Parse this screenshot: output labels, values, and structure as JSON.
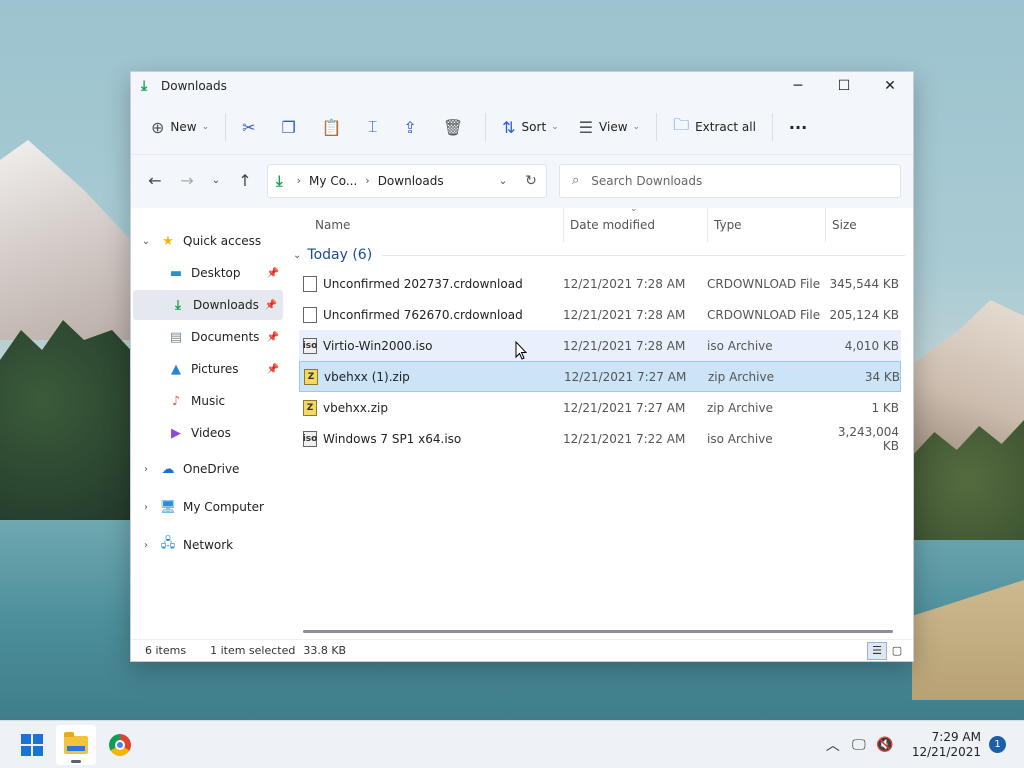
{
  "window": {
    "title": "Downloads",
    "controls": {
      "minimize": "─",
      "maximize": "☐",
      "close": "✕"
    }
  },
  "toolbar": {
    "new_label": "New",
    "sort_label": "Sort",
    "view_label": "View",
    "extract_label": "Extract all",
    "more_label": "···"
  },
  "address": {
    "crumbs": [
      "My Co...",
      "Downloads"
    ],
    "search_placeholder": "Search Downloads"
  },
  "sidebar": {
    "items": [
      {
        "label": "Quick access",
        "icon": "star-icon"
      },
      {
        "label": "Desktop",
        "icon": "desktop-icon"
      },
      {
        "label": "Downloads",
        "icon": "download-icon"
      },
      {
        "label": "Documents",
        "icon": "documents-icon"
      },
      {
        "label": "Pictures",
        "icon": "pictures-icon"
      },
      {
        "label": "Music",
        "icon": "music-icon"
      },
      {
        "label": "Videos",
        "icon": "videos-icon"
      },
      {
        "label": "OneDrive",
        "icon": "onedrive-icon"
      },
      {
        "label": "My Computer",
        "icon": "computer-icon"
      },
      {
        "label": "Network",
        "icon": "network-icon"
      }
    ]
  },
  "columns": {
    "name": "Name",
    "date": "Date modified",
    "type": "Type",
    "size": "Size"
  },
  "group": {
    "label": "Today (6)"
  },
  "files": [
    {
      "name": "Unconfirmed 202737.crdownload",
      "date": "12/21/2021 7:28 AM",
      "type": "CRDOWNLOAD File",
      "size": "345,544 KB",
      "kind": "doc"
    },
    {
      "name": "Unconfirmed 762670.crdownload",
      "date": "12/21/2021 7:28 AM",
      "type": "CRDOWNLOAD File",
      "size": "205,124 KB",
      "kind": "doc"
    },
    {
      "name": "Virtio-Win2000.iso",
      "date": "12/21/2021 7:28 AM",
      "type": "iso Archive",
      "size": "4,010 KB",
      "kind": "iso"
    },
    {
      "name": "vbehxx (1).zip",
      "date": "12/21/2021 7:27 AM",
      "type": "zip Archive",
      "size": "34 KB",
      "kind": "zip"
    },
    {
      "name": "vbehxx.zip",
      "date": "12/21/2021 7:27 AM",
      "type": "zip Archive",
      "size": "1 KB",
      "kind": "zip"
    },
    {
      "name": "Windows 7 SP1 x64.iso",
      "date": "12/21/2021 7:22 AM",
      "type": "iso Archive",
      "size": "3,243,004 KB",
      "kind": "iso"
    }
  ],
  "status": {
    "items": "6 items",
    "selected": "1 item selected",
    "size": "33.8 KB"
  },
  "taskbar": {
    "time": "7:29 AM",
    "date": "12/21/2021",
    "notifications": "1"
  },
  "colors": {
    "accent": "#1a73d9",
    "selection": "#cce4f7",
    "download_green": "#1a9e55"
  }
}
